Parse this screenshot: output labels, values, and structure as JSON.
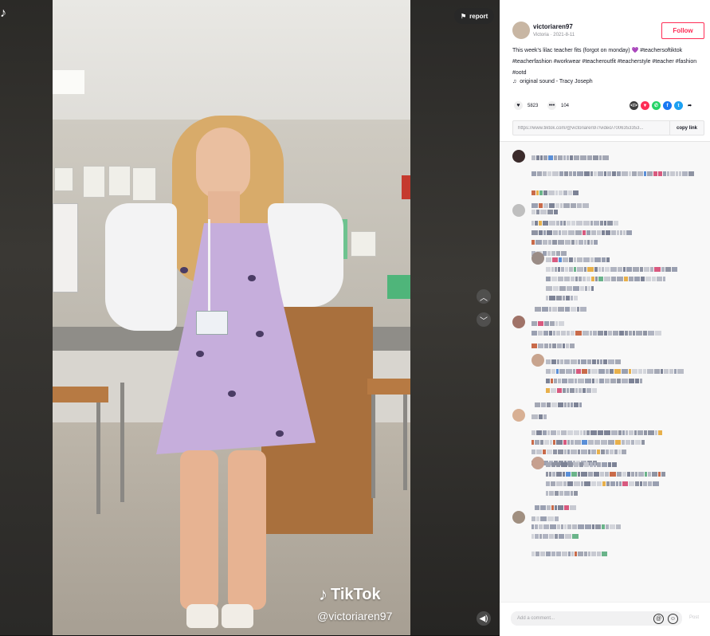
{
  "watermark": {
    "brand": "TikTok",
    "user": "@victoriaren97"
  },
  "overlay": {
    "report_label": "report",
    "report_icon": "flag-icon",
    "up_icon": "chevron-up-icon",
    "down_icon": "chevron-down-icon",
    "volume_icon": "volume-icon"
  },
  "author": {
    "username": "victoriaren97",
    "subline": "Victoria · 2021-8-11",
    "follow_label": "Follow"
  },
  "caption": "This week's lilac teacher fits (forgot on monday) 💜 #teachersoftiktok #teacherfashion #workwear #teacheroutfit #teacherstyle #teacher #fashion #ootd",
  "sound": {
    "icon": "music-note-icon",
    "label": "original sound - Tracy Joseph"
  },
  "stats": {
    "likes": "5823",
    "comments": "104"
  },
  "share_icons": [
    {
      "name": "embed-icon",
      "color": "#3d3d3d",
      "glyph": "</>"
    },
    {
      "name": "tiktok-friends-icon",
      "color": "#fe2c55",
      "glyph": "▼"
    },
    {
      "name": "whatsapp-icon",
      "color": "#25d366",
      "glyph": "✆"
    },
    {
      "name": "facebook-icon",
      "color": "#1877f2",
      "glyph": "f"
    },
    {
      "name": "twitter-icon",
      "color": "#1da1f2",
      "glyph": "t"
    },
    {
      "name": "share-arrow-icon",
      "color": "#161823",
      "glyph": "➦"
    }
  ],
  "link": {
    "url": "https://www.tiktok.com/@victoriaren97/video/7006353353...",
    "copy_label": "copy link"
  },
  "comment_input": {
    "placeholder": "Add a comment...",
    "post_label": "Post"
  },
  "colors": {
    "accent": "#fe2c55"
  }
}
